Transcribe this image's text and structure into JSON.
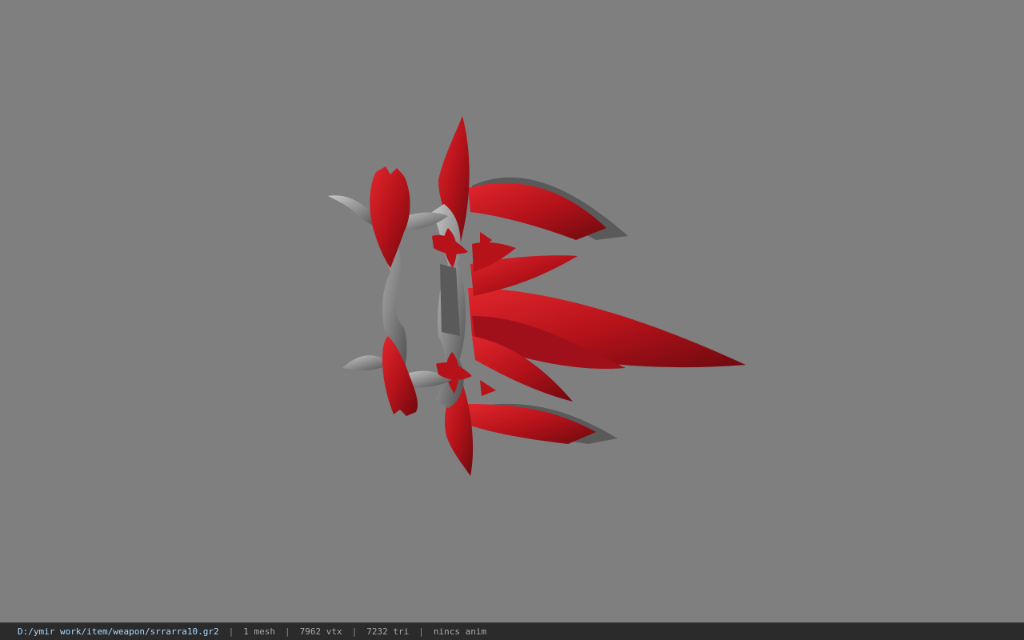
{
  "viewer": {
    "background_color": "#7f7f7f",
    "model_colors": {
      "feather_red": "#c0141b",
      "feather_dark": "#6d0a0f",
      "metal": "#8c8c8c",
      "metal_dark": "#4a4a4a"
    }
  },
  "statusbar": {
    "file_path": "D:/ymir work/item/weapon/srrarra10.gr2",
    "separator": "|",
    "mesh_count": "1 mesh",
    "vertex_count": "7962 vtx",
    "triangle_count": "7232 tri",
    "anim_status": "nincs anim"
  }
}
